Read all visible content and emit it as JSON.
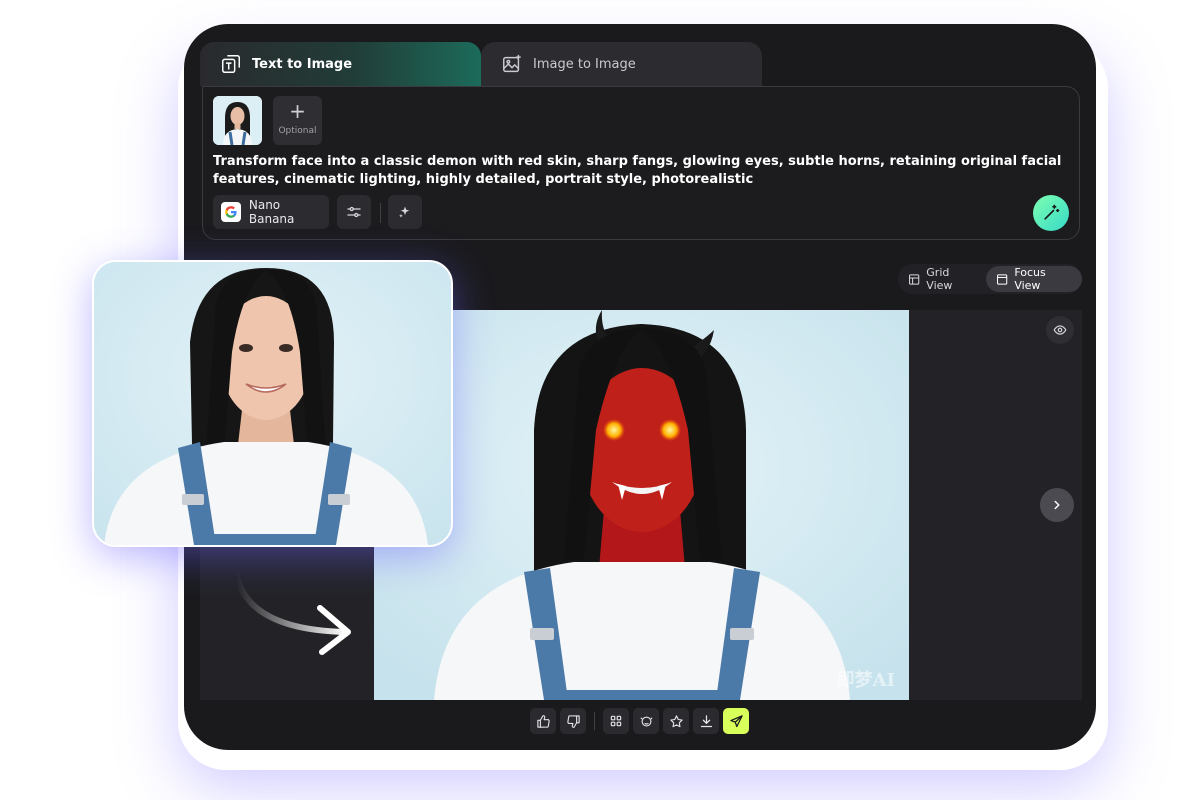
{
  "tabs": [
    {
      "label": "Text to Image",
      "icon": "text-to-image-icon",
      "active": true
    },
    {
      "label": "Image to Image",
      "icon": "image-to-image-icon",
      "active": false
    }
  ],
  "prompt": {
    "optional_label": "Optional",
    "text": "Transform face into a classic demon with red skin, sharp fangs, glowing eyes, subtle horns, retaining original facial features, cinematic lighting, highly detailed, portrait style, photorealistic",
    "model_label": "Nano Banana"
  },
  "views": {
    "grid_label": "Grid View",
    "focus_label": "Focus View",
    "active": "focus"
  },
  "result": {
    "watermark": "即梦AI"
  },
  "colors": {
    "device_bg": "#1a1a1d",
    "accent_green": "#1c6b5a",
    "send_accent": "#d8ff5a",
    "demon_red": "#c0201a"
  }
}
